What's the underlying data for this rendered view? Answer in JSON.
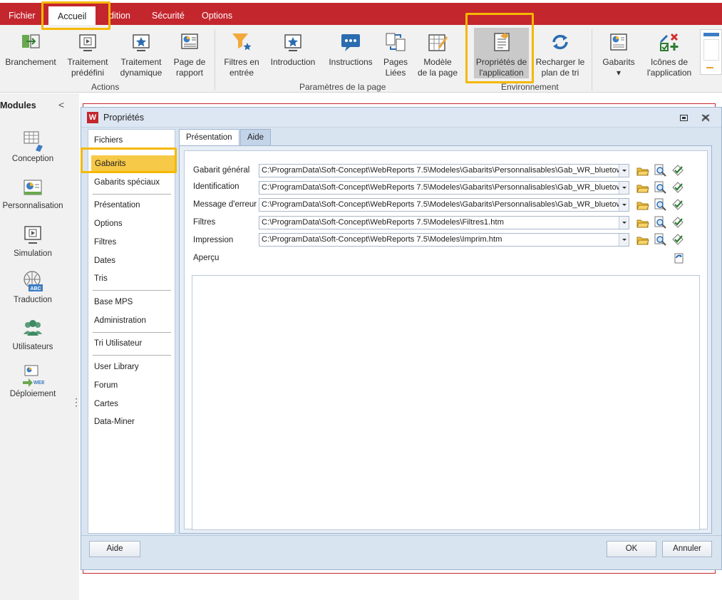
{
  "menu": {
    "items": [
      {
        "label": "Fichier",
        "active": false
      },
      {
        "label": "Accueil",
        "active": true
      },
      {
        "label": "dition",
        "active": false
      },
      {
        "label": "Sécurité",
        "active": false
      },
      {
        "label": "Options",
        "active": false
      }
    ]
  },
  "ribbon": {
    "buttons": [
      {
        "label1": "Branchement",
        "label2": "",
        "icon": "branch-icon"
      },
      {
        "label1": "Traitement",
        "label2": "prédéfini",
        "icon": "predefined-process-icon"
      },
      {
        "label1": "Traitement",
        "label2": "dynamique",
        "icon": "dynamic-process-icon"
      },
      {
        "label1": "Page de",
        "label2": "rapport",
        "icon": "report-page-icon"
      },
      {
        "label1": "Filtres en",
        "label2": "entrée",
        "icon": "filter-icon"
      },
      {
        "label1": "Introduction",
        "label2": "",
        "icon": "introduction-icon"
      },
      {
        "label1": "Instructions",
        "label2": "",
        "icon": "instructions-icon"
      },
      {
        "label1": "Pages",
        "label2": "Liées",
        "icon": "linked-pages-icon"
      },
      {
        "label1": "Modèle",
        "label2": "de la page",
        "icon": "page-template-icon"
      },
      {
        "label1": "Propriétés de",
        "label2": "l'application",
        "icon": "app-properties-icon"
      },
      {
        "label1": "Recharger le",
        "label2": "plan de tri",
        "icon": "reload-icon"
      },
      {
        "label1": "Gabarits",
        "label2": "▾",
        "icon": "templates-icon"
      },
      {
        "label1": "Icônes de",
        "label2": "l'application",
        "icon": "app-icons-icon"
      }
    ],
    "groups": {
      "actions": "Actions",
      "page_params": "Paramètres de la page",
      "environment": "Environnement"
    }
  },
  "modules": {
    "title": "Modules",
    "collapse": "<",
    "more": "⋮",
    "items": [
      {
        "label": "Conception",
        "icon": "design-icon"
      },
      {
        "label": "Personnalisation",
        "icon": "customization-icon"
      },
      {
        "label": "Simulation",
        "icon": "simulation-icon"
      },
      {
        "label": "Traduction",
        "icon": "translation-icon"
      },
      {
        "label": "Utilisateurs",
        "icon": "users-icon"
      },
      {
        "label": "Déploiement",
        "icon": "deployment-icon"
      }
    ]
  },
  "dialog": {
    "title": "Propriétés",
    "nav": [
      "Fichiers",
      "Gabarits",
      "Gabarits spéciaux",
      "Présentation",
      "Options",
      "Filtres",
      "Dates",
      "Tris",
      "Base MPS",
      "Administration",
      "Tri Utilisateur",
      "User Library",
      "Forum",
      "Cartes",
      "Data-Miner"
    ],
    "tabs": [
      "Présentation",
      "Aide"
    ],
    "fields": [
      {
        "label": "Gabarit général",
        "value": "C:\\ProgramData\\Soft-Concept\\WebReports 7.5\\Modeles\\Gabarits\\Personnalisables\\Gab_WR_bluetown"
      },
      {
        "label": "Identification",
        "value": "C:\\ProgramData\\Soft-Concept\\WebReports 7.5\\Modeles\\Gabarits\\Personnalisables\\Gab_WR_bluetown"
      },
      {
        "label": "Message d'erreur",
        "value": "C:\\ProgramData\\Soft-Concept\\WebReports 7.5\\Modeles\\Gabarits\\Personnalisables\\Gab_WR_bluetown"
      },
      {
        "label": "Filtres",
        "value": "C:\\ProgramData\\Soft-Concept\\WebReports 7.5\\Modeles\\Filtres1.htm"
      },
      {
        "label": "Impression",
        "value": "C:\\ProgramData\\Soft-Concept\\WebReports 7.5\\Modeles\\Imprim.htm"
      }
    ],
    "preview_label": "Aperçu",
    "buttons": {
      "help": "Aide",
      "ok": "OK",
      "cancel": "Annuler"
    }
  },
  "colors": {
    "accent": "#c4262e",
    "highlight": "#f5b800",
    "dialog_bg": "#d9e4f1"
  }
}
